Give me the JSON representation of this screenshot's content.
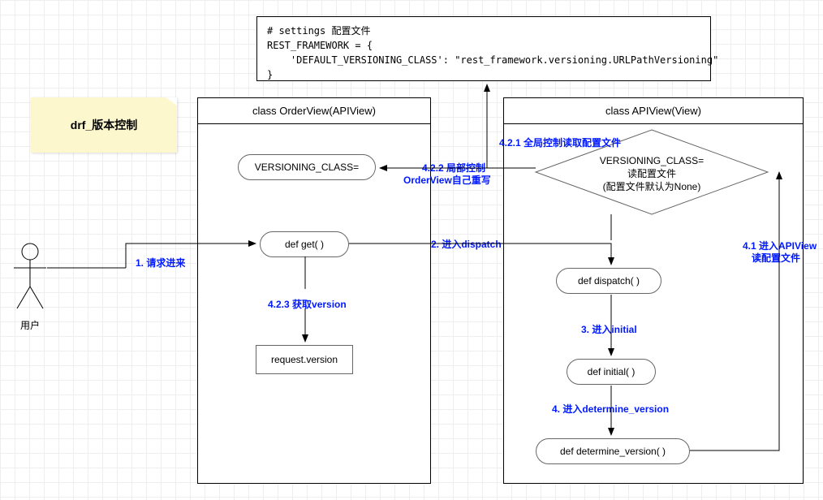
{
  "note": "drf_版本控制",
  "code": "# settings 配置文件\nREST_FRAMEWORK = {\n    'DEFAULT_VERSIONING_CLASS': \"rest_framework.versioning.URLPathVersioning\"\n}",
  "orderview": {
    "title": "class OrderView(APIView)",
    "versioning": "VERSIONING_CLASS=",
    "get": "def get( )",
    "reqver": "request.version"
  },
  "apiview": {
    "title": "class APIView(View)",
    "diamond_l1": "VERSIONING_CLASS=",
    "diamond_l2": "读配置文件",
    "diamond_l3": "(配置文件默认为None)",
    "dispatch": "def dispatch( )",
    "initial": "def initial( )",
    "determine": "def determine_version( )"
  },
  "labels": {
    "l1": "1. 请求进来",
    "l2": "2. 进入dispatch",
    "l3": "3. 进入initial",
    "l4": "4. 进入determine_version",
    "l41_a": "4.1 进入APIView",
    "l41_b": "读配置文件",
    "l421": "4.2.1 全局控制读取配置文件",
    "l422_a": "4.2.2 局部控制",
    "l422_b": "OrderView自己重写",
    "l423": "4.2.3 获取version"
  },
  "actor": "用户"
}
